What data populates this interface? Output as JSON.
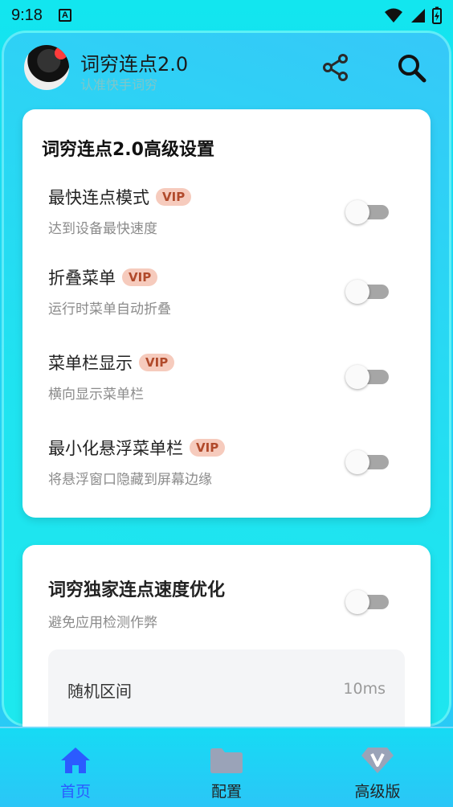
{
  "statusbar": {
    "time": "9:18",
    "badge": "A"
  },
  "header": {
    "title": "词穷连点2.0",
    "subtitle": "认准快手词穷"
  },
  "advanced": {
    "title": "词穷连点2.0高级设置",
    "vip_label": "VIP",
    "items": [
      {
        "name": "最快连点模式",
        "desc": "达到设备最快速度",
        "enabled": false
      },
      {
        "name": "折叠菜单",
        "desc": "运行时菜单自动折叠",
        "enabled": false
      },
      {
        "name": "菜单栏显示",
        "desc": "横向显示菜单栏",
        "enabled": false
      },
      {
        "name": "最小化悬浮菜单栏",
        "desc": "将悬浮窗口隐藏到屏幕边缘",
        "enabled": false
      }
    ]
  },
  "optimization": {
    "title": "词穷独家连点速度优化",
    "desc": "避免应用检测作弊",
    "enabled": false,
    "random_range": {
      "label": "随机区间",
      "value": "10ms"
    }
  },
  "nav": {
    "items": [
      {
        "label": "首页",
        "icon": "home-icon",
        "active": true
      },
      {
        "label": "配置",
        "icon": "folder-icon",
        "active": false
      },
      {
        "label": "高级版",
        "icon": "diamond-v-icon",
        "active": false
      }
    ],
    "colors": {
      "active": "#2b5bff",
      "inactive": "#9aa3b8"
    }
  }
}
